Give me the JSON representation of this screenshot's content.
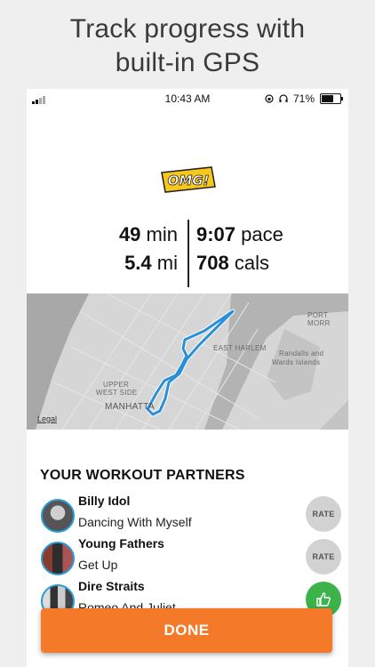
{
  "headline": {
    "line1": "Track progress with",
    "line2": "built-in GPS"
  },
  "status_bar": {
    "time": "10:43 AM",
    "battery_percent_label": "71%",
    "battery_level": 0.71
  },
  "badge": {
    "text": "OMG!"
  },
  "stats": {
    "duration_value": "49",
    "duration_unit": "min",
    "pace_value": "9:07",
    "pace_unit": "pace",
    "distance_value": "5.4",
    "distance_unit": "mi",
    "calories_value": "708",
    "calories_unit": "cals"
  },
  "map": {
    "labels": {
      "port_morris": "PORT MORR",
      "east_harlem": "EAST HARLEM",
      "randalls": "Randalls and",
      "wards": "Wards Islands",
      "upper_west_side": "UPPER",
      "west_side": "WEST SIDE",
      "manhattan": "MANHATTA",
      "legal": "Legal"
    },
    "route_color": "#2a8fd8"
  },
  "partners": {
    "title": "YOUR WORKOUT PARTNERS",
    "items": [
      {
        "artist": "Billy Idol",
        "song": "Dancing With Myself",
        "action": "RATE"
      },
      {
        "artist": "Young Fathers",
        "song": "Get Up",
        "action": "RATE"
      },
      {
        "artist": "Dire Straits",
        "song": "Romeo And Juliet",
        "action": ""
      }
    ]
  },
  "done_button": {
    "label": "DONE",
    "color": "#f47a2a"
  }
}
